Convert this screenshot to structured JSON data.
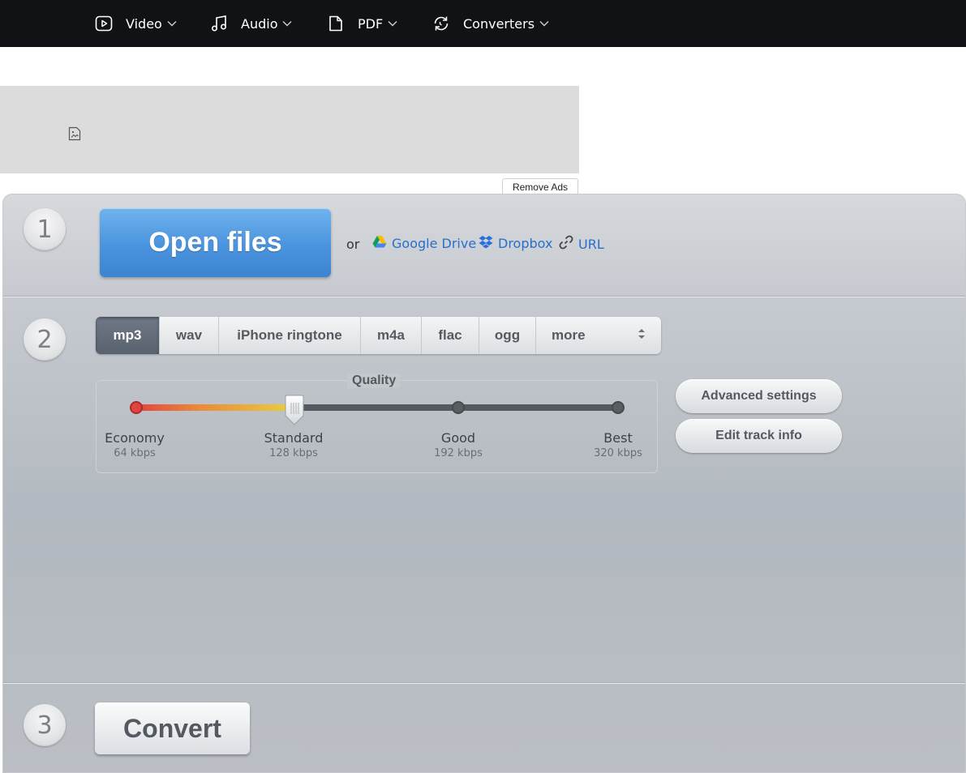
{
  "nav": {
    "items": [
      {
        "label": "Video",
        "icon": "play-icon"
      },
      {
        "label": "Audio",
        "icon": "music-note-icon"
      },
      {
        "label": "PDF",
        "icon": "document-icon"
      },
      {
        "label": "Converters",
        "icon": "refresh-icon"
      }
    ]
  },
  "ads": {
    "remove_label": "Remove Ads",
    "placeholder_icon": "broken-image-icon"
  },
  "steps": {
    "step1": {
      "number": "1",
      "open_label": "Open files",
      "or_text": "or"
    },
    "step2": {
      "number": "2"
    },
    "step3": {
      "number": "3",
      "convert_label": "Convert"
    }
  },
  "sources": [
    {
      "label": "Google Drive",
      "icon": "google-drive-icon"
    },
    {
      "label": "Dropbox",
      "icon": "dropbox-icon"
    },
    {
      "label": "URL",
      "icon": "link-icon"
    }
  ],
  "formats": {
    "selected": "mp3",
    "tabs": [
      "mp3",
      "wav",
      "iPhone ringtone",
      "m4a",
      "flac",
      "ogg",
      "more"
    ]
  },
  "quality": {
    "title": "Quality",
    "selected_index": 1,
    "levels": [
      {
        "name": "Economy",
        "bitrate": "64 kbps"
      },
      {
        "name": "Standard",
        "bitrate": "128 kbps"
      },
      {
        "name": "Good",
        "bitrate": "192 kbps"
      },
      {
        "name": "Best",
        "bitrate": "320 kbps"
      }
    ]
  },
  "buttons": {
    "advanced": "Advanced settings",
    "edit_track": "Edit track info"
  },
  "colors": {
    "topnav_bg": "#111216",
    "accent_blue": "#4a93dd",
    "link": "#2a6fc7"
  }
}
